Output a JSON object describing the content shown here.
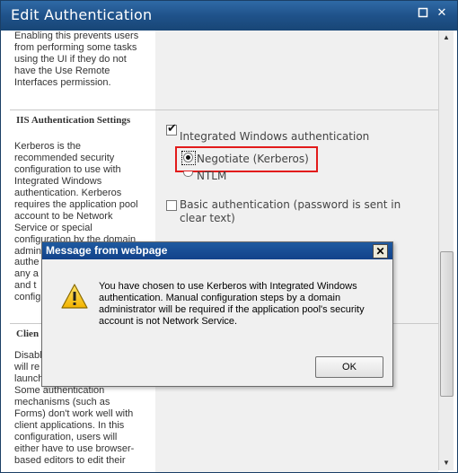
{
  "window": {
    "title": "Edit Authentication",
    "restore_glyph": "▫",
    "close_glyph": "✕"
  },
  "left": {
    "top_text": "Enabling this prevents users from performing some tasks using the UI if they do not have the Use Remote Interfaces permission.",
    "iis_heading": "IIS Authentication Settings",
    "kerberos_text": "Kerberos is the recommended security configuration to use with Integrated Windows authentication.  Kerberos requires the application pool account to be Network Service or special configuration by the domain admini",
    "partial_1": "authe",
    "partial_2": "any a",
    "partial_3": "and t",
    "partial_4": "config",
    "client_heading": "Clien",
    "client_text_partial": "Disabl will re launch",
    "client_text": "Some authentication mechanisms (such as Forms) don't work well with client applications. In this configuration, users will either have to use browser-based editors to edit their"
  },
  "right": {
    "integrated_label": "Integrated Windows authentication",
    "integrated_checked": true,
    "negotiate_label": "Negotiate (Kerberos)",
    "negotiate_selected": true,
    "ntlm_label": "NTLM",
    "basic_label": "Basic authentication (password is sent in clear text)",
    "basic_checked": false
  },
  "dialog": {
    "title": "Message from webpage",
    "close_glyph": "✕",
    "message": "You have chosen to use Kerberos with Integrated Windows authentication. Manual configuration steps by a domain administrator will be required if the application pool's security account is not Network Service.",
    "ok_label": "OK",
    "icon": "warning-icon"
  },
  "scrollbar": {
    "up_glyph": "▲",
    "down_glyph": "▼"
  },
  "colors": {
    "titlebar": "#1f528a",
    "dialog_title": "#12428a",
    "highlight_box": "#e21b1b"
  }
}
